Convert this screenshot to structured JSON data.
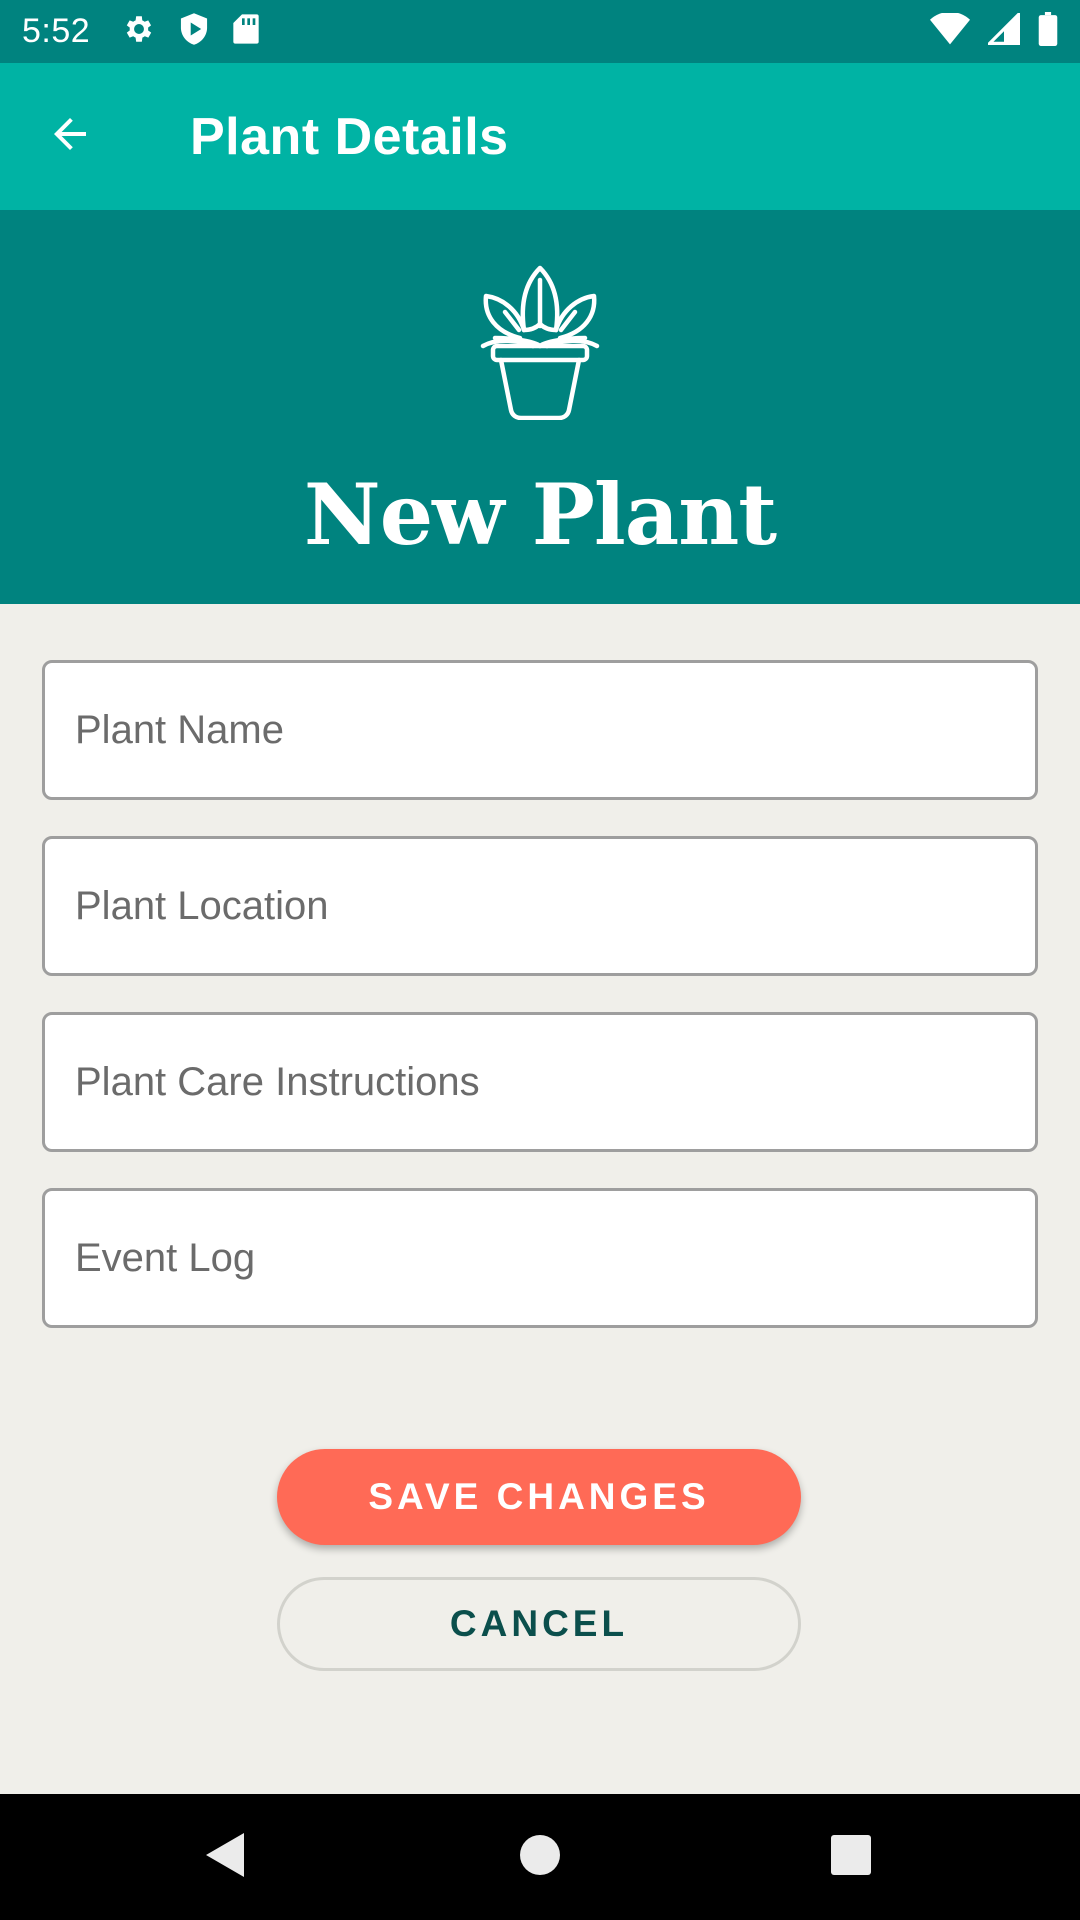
{
  "status_bar": {
    "time": "5:52",
    "left_icons": [
      "gear-icon",
      "shield-play-icon",
      "sd-card-icon"
    ],
    "right_icons": [
      "wifi-icon",
      "signal-icon",
      "battery-icon"
    ]
  },
  "app_bar": {
    "title": "Plant Details",
    "back_icon": "arrow-back-icon"
  },
  "hero": {
    "icon": "potted-plant-icon",
    "heading": "New Plant"
  },
  "form": {
    "fields": [
      {
        "placeholder": "Plant Name",
        "value": ""
      },
      {
        "placeholder": "Plant Location",
        "value": ""
      },
      {
        "placeholder": "Plant Care Instructions",
        "value": ""
      },
      {
        "placeholder": "Event Log",
        "value": ""
      }
    ]
  },
  "actions": {
    "save_label": "SAVE CHANGES",
    "cancel_label": "CANCEL"
  },
  "nav_bar": {
    "buttons": [
      "back-triangle-icon",
      "home-circle-icon",
      "recents-square-icon"
    ]
  },
  "colors": {
    "status_bar": "#00837F",
    "app_bar": "#00B3A4",
    "hero": "#00837F",
    "background": "#F0EFEA",
    "save_button": "#FF6A56",
    "cancel_text": "#0B4F4C"
  }
}
